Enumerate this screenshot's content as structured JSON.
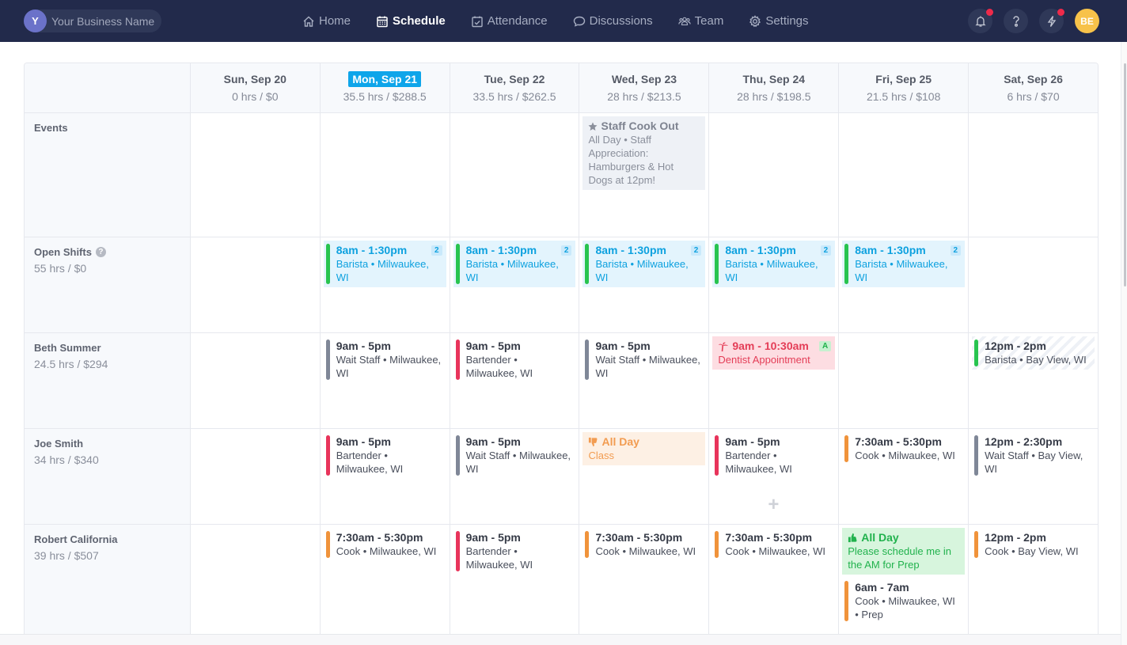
{
  "topbar": {
    "business": {
      "initial": "Y",
      "name": "Your Business Name"
    },
    "nav": [
      {
        "label": "Home",
        "icon": "home-icon",
        "active": false
      },
      {
        "label": "Schedule",
        "icon": "calendar-icon",
        "active": true
      },
      {
        "label": "Attendance",
        "icon": "calendar-check-icon",
        "active": false
      },
      {
        "label": "Discussions",
        "icon": "chat-icon",
        "active": false
      },
      {
        "label": "Team",
        "icon": "team-icon",
        "active": false
      },
      {
        "label": "Settings",
        "icon": "gear-icon",
        "active": false
      }
    ],
    "user_initials": "BE"
  },
  "colors": {
    "topbar": "#222a4b",
    "today": "#0ea5ea",
    "open": "#0da1df",
    "green": "#28c44f",
    "grey": "#7f8797",
    "red": "#e8345b",
    "orange": "#f0933b"
  },
  "days": [
    {
      "label": "Sun, Sep 20",
      "totals": "0 hrs / $0",
      "today": false
    },
    {
      "label": "Mon, Sep 21",
      "totals": "35.5 hrs / $288.5",
      "today": true
    },
    {
      "label": "Tue, Sep 22",
      "totals": "33.5 hrs / $262.5",
      "today": false
    },
    {
      "label": "Wed, Sep 23",
      "totals": "28 hrs / $213.5",
      "today": false
    },
    {
      "label": "Thu, Sep 24",
      "totals": "28 hrs / $198.5",
      "today": false
    },
    {
      "label": "Fri, Sep 25",
      "totals": "21.5 hrs / $108",
      "today": false
    },
    {
      "label": "Sat, Sep 26",
      "totals": "6 hrs / $70",
      "today": false
    }
  ],
  "rows": {
    "events": {
      "label": "Events",
      "wed": {
        "title": "Staff Cook Out",
        "desc": "All Day • Staff Appreciation: Hamburgers & Hot Dogs at 12pm!"
      }
    },
    "open_shifts": {
      "label": "Open Shifts",
      "totals": "55 hrs / $0",
      "shift": {
        "time": "8am - 1:30pm",
        "desc": "Barista • Milwaukee, WI",
        "count": "2"
      }
    },
    "beth": {
      "name": "Beth Summer",
      "totals": "24.5 hrs / $294",
      "mon": {
        "time": "9am - 5pm",
        "desc": "Wait Staff • Milwaukee, WI"
      },
      "tue": {
        "time": "9am - 5pm",
        "desc": "Bartender • Milwaukee, WI"
      },
      "wed": {
        "time": "9am - 5pm",
        "desc": "Wait Staff • Milwaukee, WI"
      },
      "thu": {
        "time": "9am - 10:30am",
        "desc": "Dentist Appointment",
        "badge": "A"
      },
      "sat": {
        "time": "12pm - 2pm",
        "desc": "Barista • Bay View, WI"
      }
    },
    "joe": {
      "name": "Joe Smith",
      "totals": "34 hrs / $340",
      "mon": {
        "time": "9am - 5pm",
        "desc": "Bartender • Milwaukee, WI"
      },
      "tue": {
        "time": "9am - 5pm",
        "desc": "Wait Staff • Milwaukee, WI"
      },
      "wed": {
        "time": "All Day",
        "desc": "Class"
      },
      "thu": {
        "time": "9am - 5pm",
        "desc": "Bartender • Milwaukee, WI"
      },
      "fri": {
        "time": "7:30am - 5:30pm",
        "desc": "Cook • Milwaukee, WI"
      },
      "sat": {
        "time": "12pm - 2:30pm",
        "desc": "Wait Staff • Bay View, WI"
      }
    },
    "robert": {
      "name": "Robert California",
      "totals": "39 hrs / $507",
      "mon": {
        "time": "7:30am - 5:30pm",
        "desc": "Cook • Milwaukee, WI"
      },
      "tue": {
        "time": "9am - 5pm",
        "desc": "Bartender • Milwaukee, WI"
      },
      "wed": {
        "time": "7:30am - 5:30pm",
        "desc": "Cook • Milwaukee, WI"
      },
      "thu": {
        "time": "7:30am - 5:30pm",
        "desc": "Cook • Milwaukee, WI"
      },
      "fri_pref": {
        "time": "All Day",
        "desc": "Please schedule me in the AM for Prep"
      },
      "fri": {
        "time": "6am - 7am",
        "desc": "Cook • Milwaukee, WI • Prep"
      },
      "sat": {
        "time": "12pm - 2pm",
        "desc": "Cook • Bay View, WI"
      }
    }
  }
}
